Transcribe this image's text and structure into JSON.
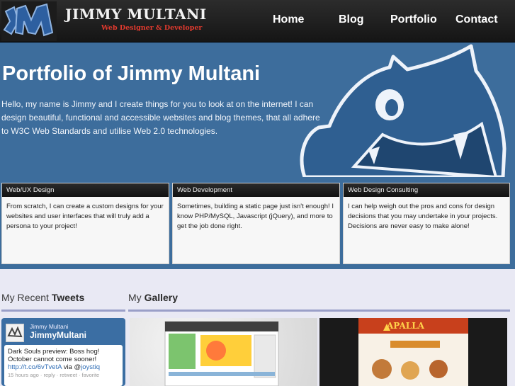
{
  "brand": {
    "name": "JIMMY MULTANI",
    "tagline": "Web Designer & Developer",
    "logo_text": "JM"
  },
  "nav": [
    "Home",
    "Blog",
    "Portfolio",
    "Contact"
  ],
  "hero": {
    "title": "Portfolio of Jimmy Multani",
    "intro": "Hello, my name is Jimmy and I create things for you to look at on the internet! I can design beautiful, functional and accessible websites and blog themes, that all adhere to W3C Web Standards and utilise Web 2.0 technologies."
  },
  "services": [
    {
      "title": "Web/UX Design",
      "body": "From scratch, I can create a custom designs for your websites and user interfaces that will truly add a persona to your project!"
    },
    {
      "title": "Web Development",
      "body": "Sometimes, building a static page just isn't enough! I know PHP/MySQL, Javascript (jQuery), and more to get the job done right."
    },
    {
      "title": "Web Design Consulting",
      "body": "I can help weigh out the pros and cons for design decisions that you may undertake in your projects. Decisions are never easy to make alone!"
    }
  ],
  "tweets_section": {
    "prefix": "My Recent",
    "bold": "Tweets"
  },
  "gallery_section": {
    "prefix": "My",
    "bold": "Gallery"
  },
  "tweet": {
    "user_small": "Jimmy Multani",
    "handle": "JimmyMultani",
    "text": "Dark Souls preview: Boss hog! October cannot come sooner!",
    "link": "http://t.co/6vTvetA",
    "via_label": "via @",
    "via": "joystiq",
    "meta": "15 hours ago · reply · retweet · favorite"
  },
  "gallery": {
    "thumb2_brand": "APALLA"
  },
  "colors": {
    "header_bg": "#1e1e1e",
    "hero_bg": "#3d6d9c",
    "accent_red": "#e23a2e",
    "rule": "#9a9fc8"
  }
}
